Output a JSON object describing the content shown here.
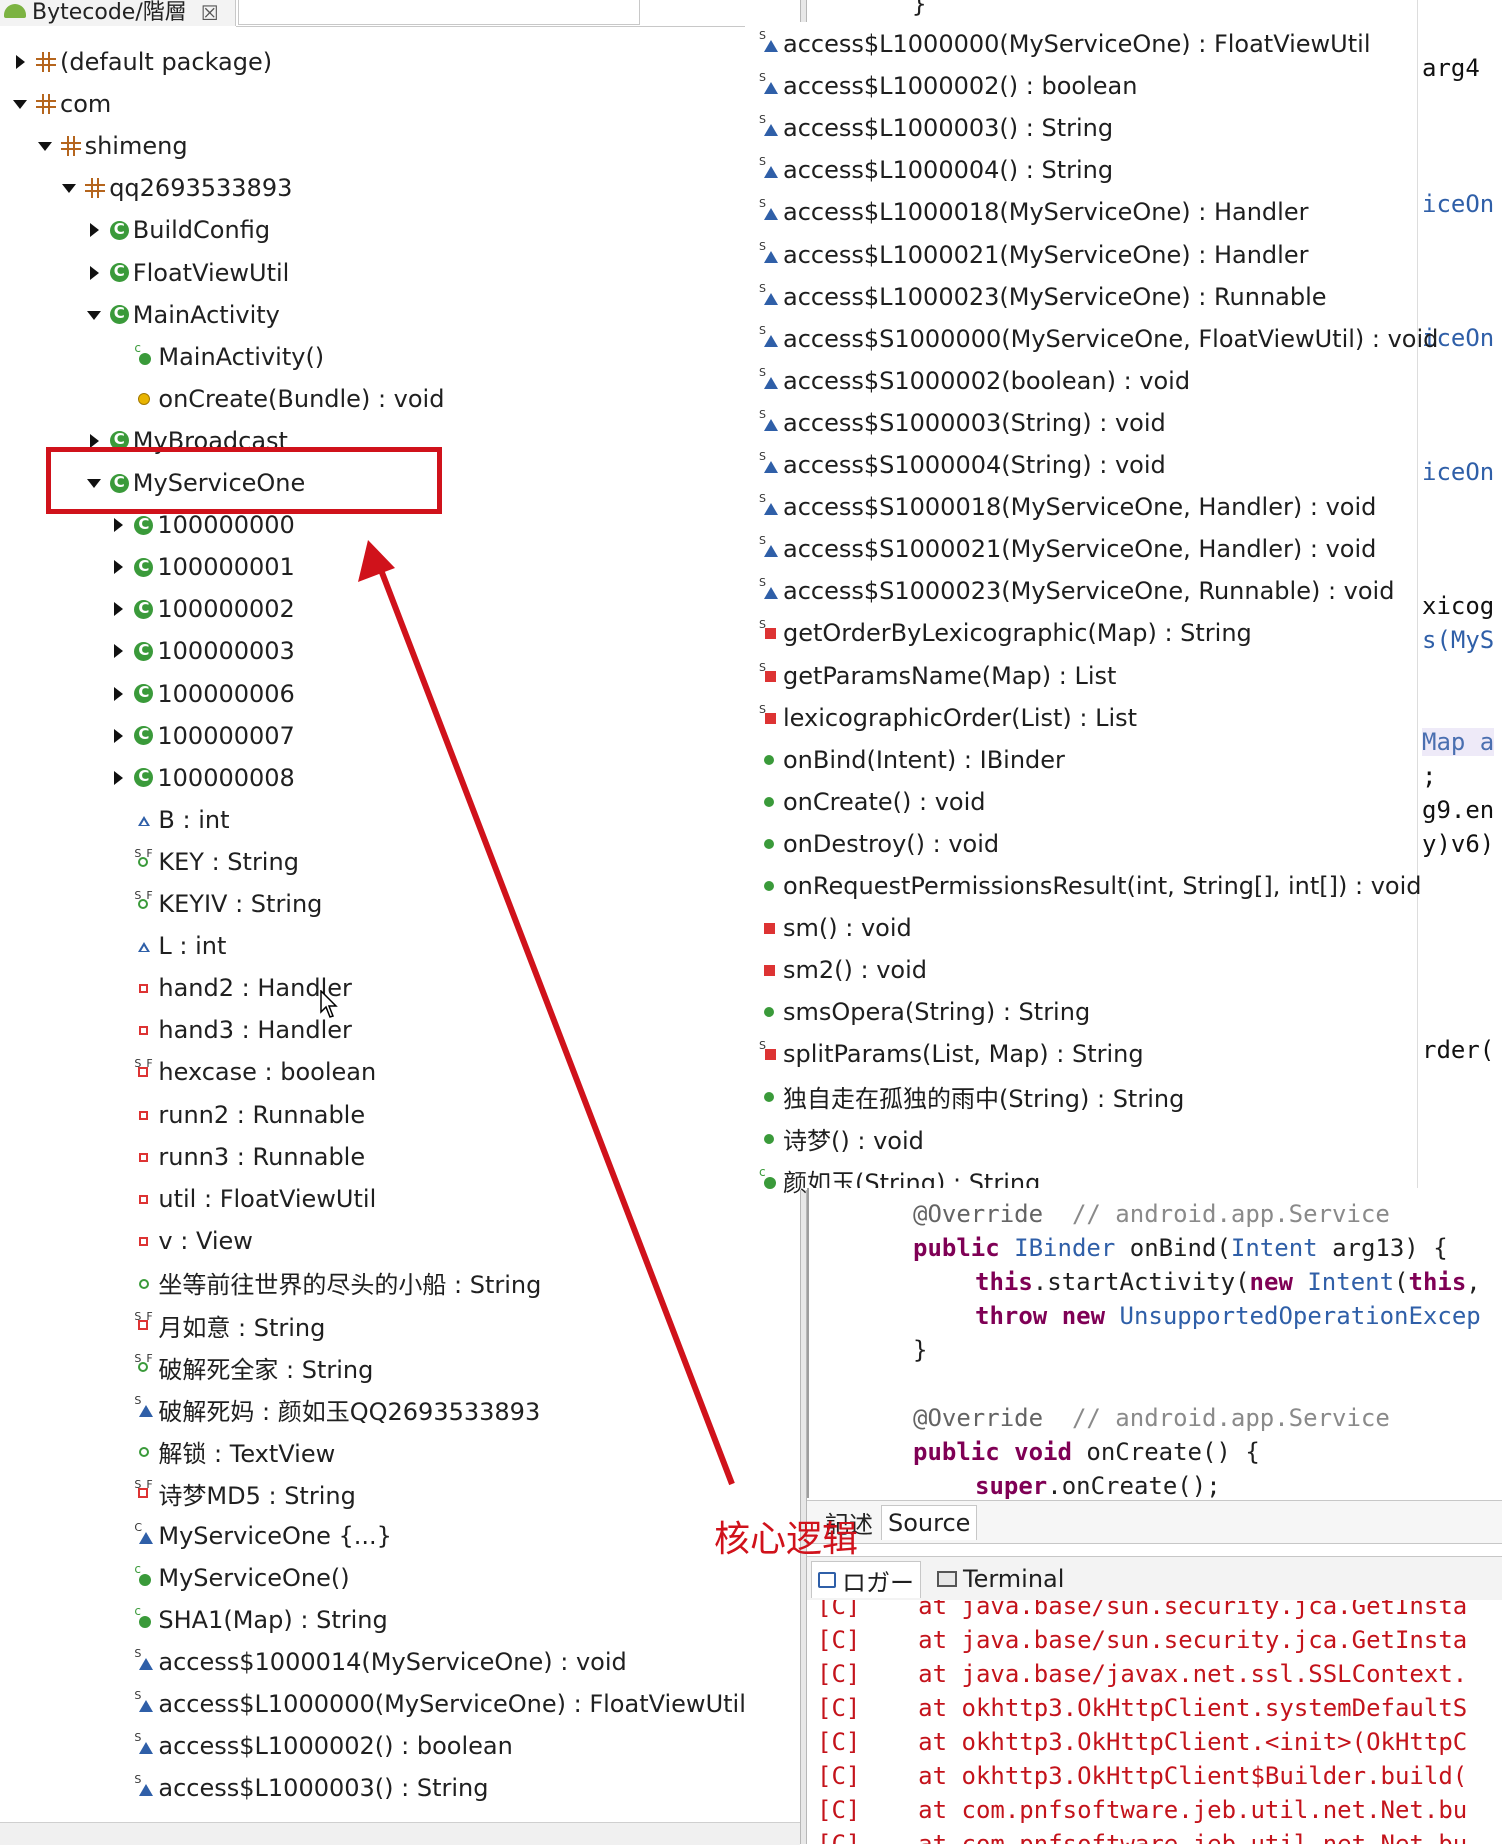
{
  "left_tab": {
    "title": "Bytecode/階層",
    "close": "☒"
  },
  "tree": [
    {
      "label": "(default package)",
      "icon": "package-icon",
      "twisty": "closed",
      "indent": 0
    },
    {
      "label": "com",
      "icon": "package-icon",
      "twisty": "open",
      "indent": 0
    },
    {
      "label": "shimeng",
      "icon": "package-icon",
      "twisty": "open",
      "indent": 1
    },
    {
      "label": "qq2693533893",
      "icon": "package-icon",
      "twisty": "open",
      "indent": 2
    },
    {
      "label": "BuildConfig",
      "icon": "class-icon",
      "twisty": "closed",
      "indent": 3
    },
    {
      "label": "FloatViewUtil",
      "icon": "class-icon",
      "twisty": "closed",
      "indent": 3
    },
    {
      "label": "MainActivity",
      "icon": "class-icon",
      "twisty": "open",
      "indent": 3
    },
    {
      "label": "MainActivity()",
      "icon": "constructor-icon",
      "twisty": "none",
      "indent": 4
    },
    {
      "label": "onCreate(Bundle) : void",
      "icon": "protected-method-icon",
      "twisty": "none",
      "indent": 4
    },
    {
      "label": "MyBroadcast",
      "icon": "class-icon",
      "twisty": "closed",
      "indent": 3
    },
    {
      "label": "MyServiceOne",
      "icon": "class-icon",
      "twisty": "open",
      "indent": 3
    },
    {
      "label": "100000000",
      "icon": "class-icon",
      "twisty": "closed",
      "indent": 4
    },
    {
      "label": "100000001",
      "icon": "class-icon",
      "twisty": "closed",
      "indent": 4
    },
    {
      "label": "100000002",
      "icon": "class-icon",
      "twisty": "closed",
      "indent": 4
    },
    {
      "label": "100000003",
      "icon": "class-icon",
      "twisty": "closed",
      "indent": 4
    },
    {
      "label": "100000006",
      "icon": "class-icon",
      "twisty": "closed",
      "indent": 4
    },
    {
      "label": "100000007",
      "icon": "class-icon",
      "twisty": "closed",
      "indent": 4
    },
    {
      "label": "100000008",
      "icon": "class-icon",
      "twisty": "closed",
      "indent": 4
    },
    {
      "label": "B : int",
      "icon": "package-field-icon",
      "twisty": "none",
      "indent": 4
    },
    {
      "label": "KEY : String",
      "icon": "static-final-field-icon",
      "twisty": "none",
      "indent": 4
    },
    {
      "label": "KEYIV : String",
      "icon": "static-final-field-icon",
      "twisty": "none",
      "indent": 4
    },
    {
      "label": "L : int",
      "icon": "package-field-icon",
      "twisty": "none",
      "indent": 4
    },
    {
      "label": "hand2 : Handler",
      "icon": "private-field-icon",
      "twisty": "none",
      "indent": 4
    },
    {
      "label": "hand3 : Handler",
      "icon": "private-field-icon",
      "twisty": "none",
      "indent": 4
    },
    {
      "label": "hexcase : boolean",
      "icon": "static-final-private-field-icon",
      "twisty": "none",
      "indent": 4
    },
    {
      "label": "runn2 : Runnable",
      "icon": "private-field-icon",
      "twisty": "none",
      "indent": 4
    },
    {
      "label": "runn3 : Runnable",
      "icon": "private-field-icon",
      "twisty": "none",
      "indent": 4
    },
    {
      "label": "util : FloatViewUtil",
      "icon": "private-field-icon",
      "twisty": "none",
      "indent": 4
    },
    {
      "label": "v : View",
      "icon": "private-field-icon",
      "twisty": "none",
      "indent": 4
    },
    {
      "label": "坐等前往世界的尽头的小船 : String",
      "icon": "public-field-icon",
      "twisty": "none",
      "indent": 4
    },
    {
      "label": "月如意 : String",
      "icon": "static-final-private-field-icon",
      "twisty": "none",
      "indent": 4
    },
    {
      "label": "破解死全家 : String",
      "icon": "static-final-field-icon",
      "twisty": "none",
      "indent": 4
    },
    {
      "label": "破解死妈 : 颜如玉QQ2693533893",
      "icon": "static-field-icon",
      "twisty": "none",
      "indent": 4
    },
    {
      "label": "解锁 : TextView",
      "icon": "public-field-icon",
      "twisty": "none",
      "indent": 4
    },
    {
      "label": "诗梦MD5 : String",
      "icon": "static-final-private-field-icon",
      "twisty": "none",
      "indent": 4
    },
    {
      "label": "MyServiceOne {...}",
      "icon": "class-initializer-icon",
      "twisty": "none",
      "indent": 4
    },
    {
      "label": "MyServiceOne()",
      "icon": "constructor-icon",
      "twisty": "none",
      "indent": 4
    },
    {
      "label": "SHA1(Map) : String",
      "icon": "constructor-icon",
      "twisty": "none",
      "indent": 4
    },
    {
      "label": "access$1000014(MyServiceOne) : void",
      "icon": "static-method-icon",
      "twisty": "none",
      "indent": 4
    },
    {
      "label": "access$L1000000(MyServiceOne) : FloatViewUtil",
      "icon": "static-method-icon",
      "twisty": "none",
      "indent": 4
    },
    {
      "label": "access$L1000002() : boolean",
      "icon": "static-method-icon",
      "twisty": "none",
      "indent": 4
    },
    {
      "label": "access$L1000003() : String",
      "icon": "static-method-icon",
      "twisty": "none",
      "indent": 4
    }
  ],
  "annotation": {
    "label": "核心逻辑",
    "color": "#d0121b"
  },
  "outline": [
    {
      "label": "access$L1000000(MyServiceOne) : FloatViewUtil",
      "icon": "static-method-icon"
    },
    {
      "label": "access$L1000002() : boolean",
      "icon": "static-method-icon"
    },
    {
      "label": "access$L1000003() : String",
      "icon": "static-method-icon"
    },
    {
      "label": "access$L1000004() : String",
      "icon": "static-method-icon"
    },
    {
      "label": "access$L1000018(MyServiceOne) : Handler",
      "icon": "static-method-icon"
    },
    {
      "label": "access$L1000021(MyServiceOne) : Handler",
      "icon": "static-method-icon"
    },
    {
      "label": "access$L1000023(MyServiceOne) : Runnable",
      "icon": "static-method-icon"
    },
    {
      "label": "access$S1000000(MyServiceOne, FloatViewUtil) : void",
      "icon": "static-method-icon"
    },
    {
      "label": "access$S1000002(boolean) : void",
      "icon": "static-method-icon"
    },
    {
      "label": "access$S1000003(String) : void",
      "icon": "static-method-icon"
    },
    {
      "label": "access$S1000004(String) : void",
      "icon": "static-method-icon"
    },
    {
      "label": "access$S1000018(MyServiceOne, Handler) : void",
      "icon": "static-method-icon"
    },
    {
      "label": "access$S1000021(MyServiceOne, Handler) : void",
      "icon": "static-method-icon"
    },
    {
      "label": "access$S1000023(MyServiceOne, Runnable) : void",
      "icon": "static-method-icon"
    },
    {
      "label": "getOrderByLexicographic(Map) : String",
      "icon": "static-private-method-icon"
    },
    {
      "label": "getParamsName(Map) : List",
      "icon": "static-private-method-icon"
    },
    {
      "label": "lexicographicOrder(List) : List",
      "icon": "static-private-method-icon"
    },
    {
      "label": "onBind(Intent) : IBinder",
      "icon": "public-method-icon"
    },
    {
      "label": "onCreate() : void",
      "icon": "public-method-icon"
    },
    {
      "label": "onDestroy() : void",
      "icon": "public-method-icon"
    },
    {
      "label": "onRequestPermissionsResult(int, String[], int[]) : void",
      "icon": "public-method-icon"
    },
    {
      "label": "sm() : void",
      "icon": "private-method-icon"
    },
    {
      "label": "sm2() : void",
      "icon": "private-method-icon"
    },
    {
      "label": "smsOpera(String) : String",
      "icon": "public-method-icon"
    },
    {
      "label": "splitParams(List, Map) : String",
      "icon": "static-private-method-icon"
    },
    {
      "label": "独自走在孤独的雨中(String) : String",
      "icon": "public-method-icon"
    },
    {
      "label": "诗梦() : void",
      "icon": "public-method-icon"
    },
    {
      "label": "颜如玉(String) : String",
      "icon": "constructor-icon"
    }
  ],
  "code_right": [
    {
      "text": "arg4"
    },
    {
      "text": "iceOn"
    },
    {
      "text": "iceOn"
    },
    {
      "text": "iceOn"
    },
    {
      "text": "xicog"
    },
    {
      "text": "s(MyS"
    },
    {
      "text": "Map a"
    },
    {
      "text": ";"
    },
    {
      "text": "g9.en"
    },
    {
      "text": "y)v6)"
    },
    {
      "text": "rder("
    }
  ],
  "top_brace": "}",
  "source": {
    "lines": [
      {
        "a": "@Override",
        "c": "  // android.app.Service"
      },
      {
        "k": "public ",
        "t": "IBinder ",
        "r": "onBind(",
        "t2": "Intent ",
        "r2": "arg13) {"
      },
      {
        "k": "this",
        "r": ".startActivity(",
        "k2": "new ",
        "t2": "Intent",
        "r2": "(",
        "k3": "this",
        "r3": ","
      },
      {
        "k": "throw new ",
        "t": "UnsupportedOperationExcep"
      },
      {
        "r": "}"
      },
      {
        "r": ""
      },
      {
        "a": "@Override",
        "c": "  // android.app.Service"
      },
      {
        "k": "public void ",
        "r": "onCreate() {"
      },
      {
        "k": "super",
        "r": ".onCreate();"
      }
    ]
  },
  "source_tabs": {
    "desc": "記述",
    "source": "Source"
  },
  "console_tabs": {
    "logger": "ロガー",
    "terminal": "Terminal"
  },
  "console": [
    "[C]    at java.base/sun.security.jca.GetInsta",
    "[C]    at java.base/sun.security.jca.GetInsta",
    "[C]    at java.base/javax.net.ssl.SSLContext.",
    "[C]    at okhttp3.OkHttpClient.systemDefaultS",
    "[C]    at okhttp3.OkHttpClient.<init>(OkHttpC",
    "[C]    at okhttp3.OkHttpClient$Builder.build(",
    "[C]    at com.pnfsoftware.jeb.util.net.Net.bu",
    "[C]    at com.pnfsoftware.jeb.util.net.Net.bu"
  ]
}
